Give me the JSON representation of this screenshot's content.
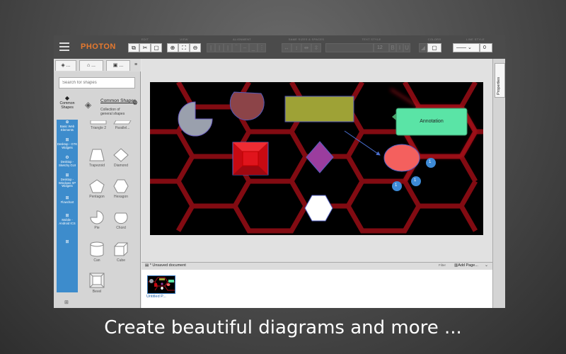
{
  "app": {
    "brand": "PHOTON"
  },
  "toolbar": {
    "groups": {
      "edit": "EDIT",
      "view": "VIEW",
      "alignment": "ALIGNMENT",
      "same_sizes": "SAME SIZES & SPACES",
      "text_style": "TEXT STYLE",
      "colors": "COLORS",
      "line_style": "LINE STYLE"
    },
    "font_size": "12",
    "font_placeholder": "",
    "line_width": "0",
    "icons": [
      "menu-icon",
      "copy-icon",
      "cut-icon",
      "paste-icon",
      "zoom-in-icon",
      "fit-icon",
      "zoom-out-icon",
      "fill-color-icon",
      "stroke-color-icon",
      "line-style-icon"
    ]
  },
  "left_panel": {
    "tabs": [
      {
        "icon": "layers-icon",
        "label": "..."
      },
      {
        "icon": "toolbox-icon",
        "label": "..."
      },
      {
        "icon": "image-icon",
        "label": "..."
      }
    ],
    "search_placeholder": "Search for shapes",
    "selected_category": "Common Shapes",
    "categories": [
      {
        "icon": "globe-icon",
        "label": "Basic Web Elements"
      },
      {
        "icon": "grid-icon",
        "label": "Desktop - GTK Widgets"
      },
      {
        "icon": "settings-icon",
        "label": "Desktop - Sketchy GUI"
      },
      {
        "icon": "grid-icon",
        "label": "Desktop - Windows XP Widgets"
      },
      {
        "icon": "grid-icon",
        "label": "Flowchart"
      },
      {
        "icon": "grid-icon",
        "label": "Mobile - Android ICS"
      },
      {
        "icon": "grid-icon",
        "label": ""
      }
    ],
    "library": {
      "title": "Common Shapes",
      "description": "Collection of general shapes"
    },
    "shapes": [
      "Triangle 2",
      "Parallel...",
      "Trapezoid",
      "Diamond",
      "Pentagon",
      "Hexagon",
      "Pie",
      "Chord",
      "Can",
      "Cube",
      "Bevel"
    ]
  },
  "canvas": {
    "annotation_text": "Annotation",
    "badges": [
      "1",
      "1",
      "1"
    ]
  },
  "right_panel": {
    "properties_label": "Properties"
  },
  "pages": {
    "document_title": "* Unsaved document",
    "filter_label": "Filter",
    "add_page_label": "Add Page...",
    "items": [
      {
        "label": "Untitled P..."
      }
    ]
  },
  "caption": "Create beautiful diagrams and more ..."
}
